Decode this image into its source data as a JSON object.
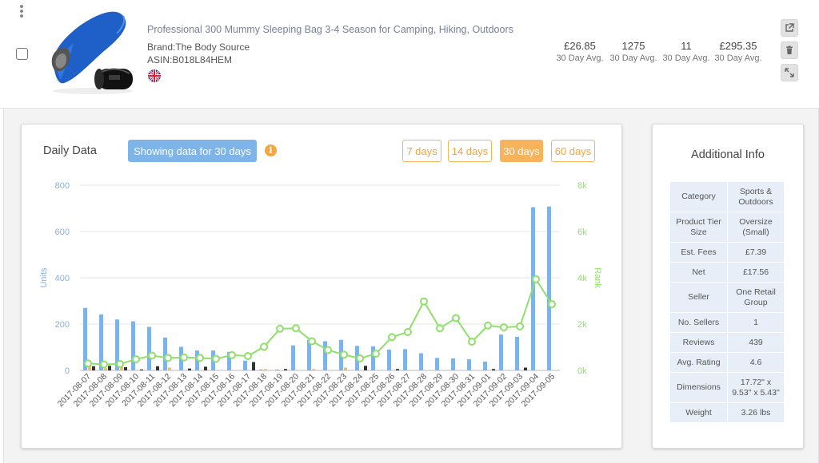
{
  "product": {
    "title": "Professional 300 Mummy Sleeping Bag 3-4 Season for Camping, Hiking, Outdoors",
    "brand": "Brand:The Body Source",
    "asin": "ASIN:B018L84HEM",
    "image_icon": "sleeping-bag-image",
    "flag_icon": "uk-flag-icon"
  },
  "metrics": [
    {
      "value": "£26.85",
      "label": "30 Day Avg."
    },
    {
      "value": "1275",
      "label": "30 Day Avg."
    },
    {
      "value": "11",
      "label": "30 Day Avg."
    },
    {
      "value": "£295.35",
      "label": "30 Day Avg."
    }
  ],
  "actions": [
    "external-link-icon",
    "trash-icon",
    "expand-icon"
  ],
  "daily": {
    "title": "Daily Data",
    "showing": "Showing data for 30 days",
    "info_icon": "i",
    "ranges": [
      {
        "label": "7 days",
        "active": false
      },
      {
        "label": "14 days",
        "active": false
      },
      {
        "label": "30 days",
        "active": true
      },
      {
        "label": "60 days",
        "active": false
      }
    ]
  },
  "chart_data": {
    "type": "bar",
    "ylabel": "Units",
    "y2label": "Rank",
    "ylim": [
      0,
      800
    ],
    "y2lim": [
      0,
      8000
    ],
    "yticks": [
      "0",
      "200",
      "400",
      "600",
      "800"
    ],
    "y2ticks": [
      "0k",
      "2k",
      "4k",
      "6k",
      "8k"
    ],
    "grid": true,
    "colors": {
      "blue": "#7db3ea",
      "orange": "#f6b96c",
      "dark": "#333333",
      "rank": "#8ee06a"
    },
    "categories": [
      "2017-08-07",
      "2017-08-08",
      "2017-08-09",
      "2017-08-10",
      "2017-08-11",
      "2017-08-12",
      "2017-08-13",
      "2017-08-14",
      "2017-08-15",
      "2017-08-16",
      "2017-08-17",
      "2017-08-18",
      "2017-08-19",
      "2017-08-20",
      "2017-08-21",
      "2017-08-22",
      "2017-08-23",
      "2017-08-24",
      "2017-08-25",
      "2017-08-26",
      "2017-08-27",
      "2017-08-28",
      "2017-08-29",
      "2017-08-30",
      "2017-08-31",
      "2017-09-01",
      "2017-09-02",
      "2017-09-03",
      "2017-09-04",
      "2017-09-05"
    ],
    "series": [
      {
        "values": [
          270,
          242,
          220,
          212,
          188,
          142,
          102,
          86,
          86,
          80,
          42,
          4,
          4,
          108,
          132,
          126,
          132,
          106,
          104,
          90,
          92,
          74,
          54,
          52,
          48,
          38,
          155,
          145,
          705,
          708
        ]
      },
      {
        "values": [
          20,
          10,
          18,
          0,
          0,
          12,
          0,
          0,
          0,
          0,
          0,
          6,
          0,
          0,
          6,
          0,
          12,
          0,
          0,
          0,
          0,
          0,
          0,
          0,
          0,
          0,
          0,
          0,
          0,
          0
        ]
      },
      {
        "values": [
          18,
          20,
          14,
          4,
          18,
          0,
          8,
          16,
          0,
          0,
          36,
          0,
          6,
          0,
          0,
          0,
          0,
          20,
          0,
          6,
          0,
          0,
          0,
          0,
          0,
          6,
          0,
          12,
          0,
          0
        ]
      },
      {
        "values": [
          300,
          260,
          280,
          480,
          640,
          540,
          560,
          540,
          500,
          660,
          620,
          1020,
          1800,
          1820,
          1260,
          880,
          680,
          520,
          720,
          1440,
          1660,
          2980,
          1820,
          2260,
          1240,
          1940,
          1860,
          1900,
          3940,
          2860
        ]
      }
    ]
  },
  "additional": {
    "title": "Additional Info",
    "rows": [
      {
        "k": "Category",
        "v": "Sports & Outdoors"
      },
      {
        "k": "Product Tier Size",
        "v": "Oversize (Small)"
      },
      {
        "k": "Est. Fees",
        "v": "£7.39"
      },
      {
        "k": "Net",
        "v": "£17.56"
      },
      {
        "k": "Seller",
        "v": "One Retail Group"
      },
      {
        "k": "No. Sellers",
        "v": "1"
      },
      {
        "k": "Reviews",
        "v": "439"
      },
      {
        "k": "Avg. Rating",
        "v": "4.6"
      },
      {
        "k": "Dimensions",
        "v": "17.72\" x 9.53\" x 5.43\""
      },
      {
        "k": "Weight",
        "v": "3.26 lbs"
      }
    ]
  }
}
